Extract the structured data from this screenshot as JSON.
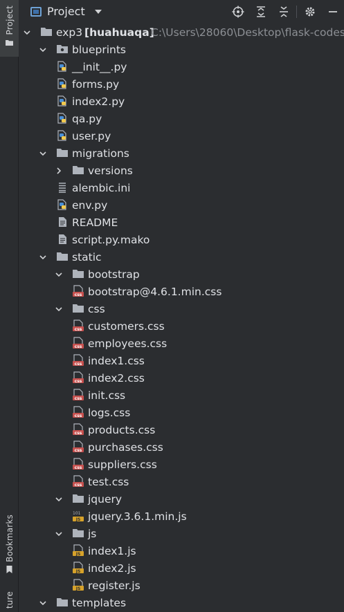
{
  "sidebar": {
    "project_tab": "Project",
    "bookmarks_tab": "Bookmarks",
    "structure_tab_partial": "ture"
  },
  "header": {
    "title": "Project",
    "actions": [
      "locate-icon",
      "expand-all-icon",
      "collapse-all-icon",
      "gear-icon",
      "hide-icon"
    ]
  },
  "tree": {
    "root": {
      "name": "exp3",
      "module": "[huahuaqa]",
      "path": "C:\\Users\\28060\\Desktop\\flask-codes"
    },
    "items": [
      {
        "label": "blueprints",
        "kind": "folder-pkg",
        "open": true,
        "depth": 1
      },
      {
        "label": "__init__.py",
        "kind": "py",
        "depth": 2
      },
      {
        "label": "forms.py",
        "kind": "py",
        "depth": 2
      },
      {
        "label": "index2.py",
        "kind": "py",
        "depth": 2
      },
      {
        "label": "qa.py",
        "kind": "py",
        "depth": 2
      },
      {
        "label": "user.py",
        "kind": "py",
        "depth": 2
      },
      {
        "label": "migrations",
        "kind": "folder",
        "open": true,
        "depth": 1
      },
      {
        "label": "versions",
        "kind": "folder",
        "open": false,
        "depth": 2
      },
      {
        "label": "alembic.ini",
        "kind": "ini",
        "depth": 2
      },
      {
        "label": "env.py",
        "kind": "py",
        "depth": 2
      },
      {
        "label": "README",
        "kind": "text",
        "depth": 2
      },
      {
        "label": "script.py.mako",
        "kind": "text",
        "depth": 2
      },
      {
        "label": "static",
        "kind": "folder",
        "open": true,
        "depth": 1
      },
      {
        "label": "bootstrap",
        "kind": "folder",
        "open": true,
        "depth": 2
      },
      {
        "label": "bootstrap@4.6.1.min.css",
        "kind": "css",
        "depth": 3
      },
      {
        "label": "css",
        "kind": "folder",
        "open": true,
        "depth": 2
      },
      {
        "label": "customers.css",
        "kind": "css",
        "depth": 3
      },
      {
        "label": "employees.css",
        "kind": "css",
        "depth": 3
      },
      {
        "label": "index1.css",
        "kind": "css",
        "depth": 3
      },
      {
        "label": "index2.css",
        "kind": "css",
        "depth": 3
      },
      {
        "label": "init.css",
        "kind": "css",
        "depth": 3
      },
      {
        "label": "logs.css",
        "kind": "css",
        "depth": 3
      },
      {
        "label": "products.css",
        "kind": "css",
        "depth": 3
      },
      {
        "label": "purchases.css",
        "kind": "css",
        "depth": 3
      },
      {
        "label": "suppliers.css",
        "kind": "css",
        "depth": 3
      },
      {
        "label": "test.css",
        "kind": "css",
        "depth": 3
      },
      {
        "label": "jquery",
        "kind": "folder",
        "open": true,
        "depth": 2
      },
      {
        "label": "jquery.3.6.1.min.js",
        "kind": "minjs",
        "depth": 3
      },
      {
        "label": "js",
        "kind": "folder",
        "open": true,
        "depth": 2
      },
      {
        "label": "index1.js",
        "kind": "js",
        "depth": 3
      },
      {
        "label": "index2.js",
        "kind": "js",
        "depth": 3
      },
      {
        "label": "register.js",
        "kind": "js",
        "depth": 3
      },
      {
        "label": "templates",
        "kind": "folder",
        "open": true,
        "depth": 1
      }
    ]
  },
  "colors": {
    "background": "#2b2d30",
    "text": "#dfe1e5",
    "path_text": "#8c8f94",
    "folder": "#aeb3bb",
    "python_blue": "#4a8fd6",
    "python_yellow": "#f2c94c",
    "css_red": "#c6504e",
    "js_yellow": "#d7a22a"
  }
}
